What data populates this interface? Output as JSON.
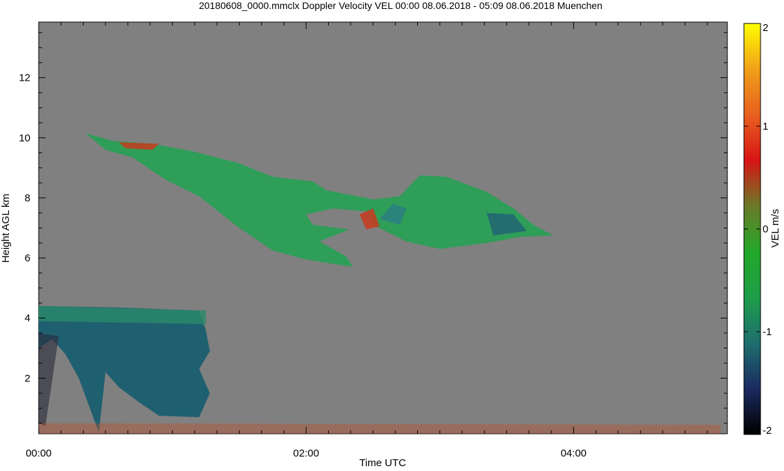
{
  "chart_data": {
    "type": "heatmap",
    "title": "20180608_0000.mmclx Doppler Velocity VEL   00:00 08.06.2018 - 05:09 08.06.2018 Muenchen",
    "xlabel": "Time UTC",
    "ylabel": "Height AGL km",
    "x_tick_labels": [
      "00:00",
      "02:00",
      "04:00"
    ],
    "x_tick_values_hours": [
      0,
      2,
      4
    ],
    "xlim_hours": [
      0,
      5.15
    ],
    "y_tick_labels": [
      "2",
      "4",
      "6",
      "8",
      "10",
      "12"
    ],
    "y_tick_values_km": [
      2,
      4,
      6,
      8,
      10,
      12
    ],
    "ylim_km": [
      0.15,
      13.85
    ],
    "grid": false,
    "background_color": "#808080",
    "colorbar": {
      "label": "VEL m/s",
      "range": [
        -2,
        2
      ],
      "tick_labels": [
        "-2",
        "-1",
        "0",
        "1",
        "2"
      ],
      "tick_values": [
        -2,
        -1,
        0,
        1,
        2
      ],
      "colors": [
        "#000000",
        "#1a2a60",
        "#1e6e6e",
        "#1e9e4a",
        "#22a828",
        "#6a7a28",
        "#d81414",
        "#e86020",
        "#f0a018",
        "#ffff00"
      ]
    },
    "features": [
      {
        "name": "upper cirrus layer",
        "time_range_hours": [
          0.35,
          3.85
        ],
        "height_range_km": [
          5.7,
          10.2
        ],
        "dominant_velocity_ms": -0.4,
        "color": "#2e9e58"
      },
      {
        "name": "lower cloud with fall streaks",
        "time_range_hours": [
          0,
          1.3
        ],
        "height_range_km": [
          0.2,
          4.4
        ],
        "dominant_velocity_ms": -1.3,
        "color": "#1f6070"
      },
      {
        "name": "near-surface clutter",
        "time_range_hours": [
          0,
          5.1
        ],
        "height_range_km": [
          0.15,
          0.5
        ],
        "dominant_velocity_ms": 0.5,
        "color": "#c84a20"
      }
    ]
  }
}
